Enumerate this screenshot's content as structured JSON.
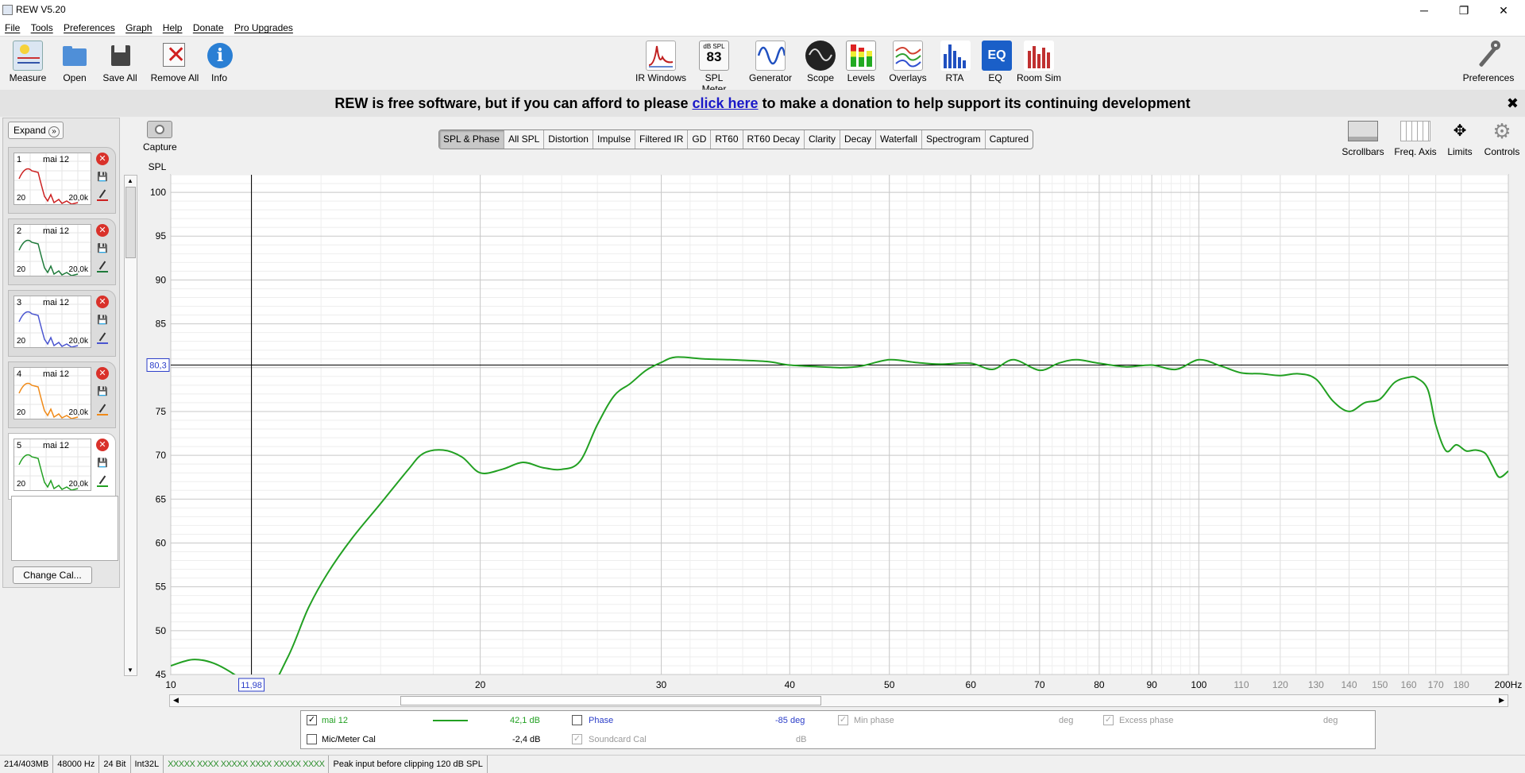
{
  "window": {
    "title": "REW V5.20",
    "minimize": "─",
    "restore": "❐",
    "close": "✕"
  },
  "menu": [
    "File",
    "Tools",
    "Preferences",
    "Graph",
    "Help",
    "Donate",
    "Pro Upgrades"
  ],
  "toolbar_left": [
    {
      "label": "Measure",
      "icon": "measure-icon"
    },
    {
      "label": "Open",
      "icon": "folder-icon"
    },
    {
      "label": "Save All",
      "icon": "save-icon"
    },
    {
      "label": "Remove All",
      "icon": "remove-icon"
    },
    {
      "label": "Info",
      "icon": "info-icon"
    }
  ],
  "toolbar_center": [
    {
      "label": "IR Windows",
      "icon": "ir-windows-icon"
    },
    {
      "label": "SPL Meter",
      "icon": "spl-meter-icon",
      "top": "dB SPL",
      "value": "83"
    },
    {
      "label": "Generator",
      "icon": "generator-icon"
    },
    {
      "label": "Scope",
      "icon": "scope-icon"
    },
    {
      "label": "Levels",
      "icon": "levels-icon"
    },
    {
      "label": "Overlays",
      "icon": "overlays-icon"
    },
    {
      "label": "RTA",
      "icon": "rta-icon"
    },
    {
      "label": "EQ",
      "icon": "eq-icon"
    },
    {
      "label": "Room Sim",
      "icon": "room-sim-icon"
    }
  ],
  "toolbar_right": {
    "label": "Preferences",
    "icon": "wrench-icon"
  },
  "banner": {
    "pre": "REW is free software, but if you can afford to please ",
    "link": "click here",
    "post": " to make a donation to help support its continuing development",
    "close": "✖"
  },
  "left_panel": {
    "expand": "Expand",
    "change_cal": "Change Cal...",
    "measurements": [
      {
        "num": "1",
        "name": "mai 12",
        "color": "#cc2020",
        "lo": "20",
        "hi": "20,0k"
      },
      {
        "num": "2",
        "name": "mai 12",
        "color": "#1e7a3a",
        "lo": "20",
        "hi": "20,0k"
      },
      {
        "num": "3",
        "name": "mai 12",
        "color": "#4a55d0",
        "lo": "20",
        "hi": "20,0k"
      },
      {
        "num": "4",
        "name": "mai 12",
        "color": "#f08a18",
        "lo": "20",
        "hi": "20,0k"
      },
      {
        "num": "5",
        "name": "mai 12",
        "color": "#22a022",
        "lo": "20",
        "hi": "20,0k"
      }
    ]
  },
  "capture": {
    "label": "Capture"
  },
  "tabs": [
    "SPL & Phase",
    "All SPL",
    "Distortion",
    "Impulse",
    "Filtered IR",
    "GD",
    "RT60",
    "RT60 Decay",
    "Clarity",
    "Decay",
    "Waterfall",
    "Spectrogram",
    "Captured"
  ],
  "active_tab": "SPL & Phase",
  "right_tools": [
    {
      "label": "Scrollbars",
      "icon": "scrollbars-icon"
    },
    {
      "label": "Freq. Axis",
      "icon": "freq-axis-icon"
    },
    {
      "label": "Limits",
      "icon": "limits-icon"
    },
    {
      "label": "Controls",
      "icon": "gear-icon"
    }
  ],
  "chart_data": {
    "type": "line",
    "ylabel": "SPL",
    "xunit": "Hz",
    "xscale": "log",
    "xlim": [
      10,
      200
    ],
    "ylim": [
      45,
      102
    ],
    "yticks": [
      45,
      50,
      55,
      60,
      65,
      70,
      75,
      80,
      85,
      90,
      95,
      100
    ],
    "xticks": [
      {
        "v": 10,
        "label": "10",
        "major": true
      },
      {
        "v": 20,
        "label": "20",
        "major": true
      },
      {
        "v": 30,
        "label": "30",
        "major": true
      },
      {
        "v": 40,
        "label": "40",
        "major": true
      },
      {
        "v": 50,
        "label": "50",
        "major": true
      },
      {
        "v": 60,
        "label": "60",
        "major": true
      },
      {
        "v": 70,
        "label": "70",
        "major": true
      },
      {
        "v": 80,
        "label": "80",
        "major": true
      },
      {
        "v": 90,
        "label": "90",
        "major": true
      },
      {
        "v": 100,
        "label": "100",
        "major": true
      },
      {
        "v": 110,
        "label": "110",
        "major": false
      },
      {
        "v": 120,
        "label": "120",
        "major": false
      },
      {
        "v": 130,
        "label": "130",
        "major": false
      },
      {
        "v": 140,
        "label": "140",
        "major": false
      },
      {
        "v": 150,
        "label": "150",
        "major": false
      },
      {
        "v": 160,
        "label": "160",
        "major": false
      },
      {
        "v": 170,
        "label": "170",
        "major": false
      },
      {
        "v": 180,
        "label": "180",
        "major": false
      },
      {
        "v": 200,
        "label": "200Hz",
        "major": true
      }
    ],
    "cursor": {
      "x": 11.98,
      "y": 80.3,
      "x_label": "11,98",
      "y_label": "80,3"
    },
    "series": [
      {
        "name": "mai 12",
        "color": "#22a022",
        "x": [
          10,
          10.5,
          11,
          11.6,
          12.3,
          13,
          13.6,
          14.2,
          15,
          16,
          17,
          17.6,
          18.4,
          19.2,
          20,
          21,
          22,
          23,
          24,
          25,
          26,
          27,
          28,
          29,
          30,
          31,
          33,
          35,
          38,
          40,
          43,
          45,
          47,
          50,
          53,
          56,
          60,
          63,
          66,
          70,
          73,
          76,
          80,
          85,
          90,
          95,
          100,
          105,
          110,
          115,
          120,
          125,
          130,
          135,
          140,
          145,
          150,
          155,
          160,
          163,
          167,
          170,
          174,
          178,
          182,
          186,
          190,
          193,
          196,
          200
        ],
        "y": [
          46.0,
          46.7,
          46.3,
          44.8,
          42.5,
          47.0,
          52.5,
          56.5,
          60.5,
          64.5,
          68.3,
          70.2,
          70.6,
          69.8,
          68.0,
          68.4,
          69.2,
          68.6,
          68.4,
          69.3,
          73.5,
          76.8,
          78.2,
          79.7,
          80.6,
          81.2,
          81.0,
          80.9,
          80.7,
          80.3,
          80.1,
          80.0,
          80.2,
          80.9,
          80.6,
          80.4,
          80.5,
          79.8,
          80.9,
          79.7,
          80.5,
          80.9,
          80.5,
          80.1,
          80.3,
          79.8,
          80.9,
          80.2,
          79.4,
          79.3,
          79.1,
          79.3,
          78.7,
          76.2,
          75.0,
          76.0,
          76.4,
          78.3,
          78.9,
          78.8,
          77.5,
          73.5,
          70.5,
          71.2,
          70.5,
          70.6,
          70.2,
          68.8,
          67.5,
          68.2
        ]
      }
    ]
  },
  "legend": {
    "row1": {
      "name": "mai 12",
      "value": "42,1 dB",
      "phase": "Phase",
      "phase_value": "-85 deg",
      "min_phase": "Min phase",
      "min_phase_unit": "deg",
      "excess_phase": "Excess phase",
      "excess_unit": "deg"
    },
    "row2": {
      "name": "Mic/Meter Cal",
      "value": "-2,4 dB",
      "soundcard": "Soundcard Cal",
      "soundcard_unit": "dB"
    }
  },
  "status": [
    "214/403MB",
    "48000 Hz",
    "24 Bit",
    "Int32L",
    "XXXXX XXXX  XXXXX XXXX  XXXXX XXXX",
    "Peak input before clipping 120 dB SPL"
  ]
}
